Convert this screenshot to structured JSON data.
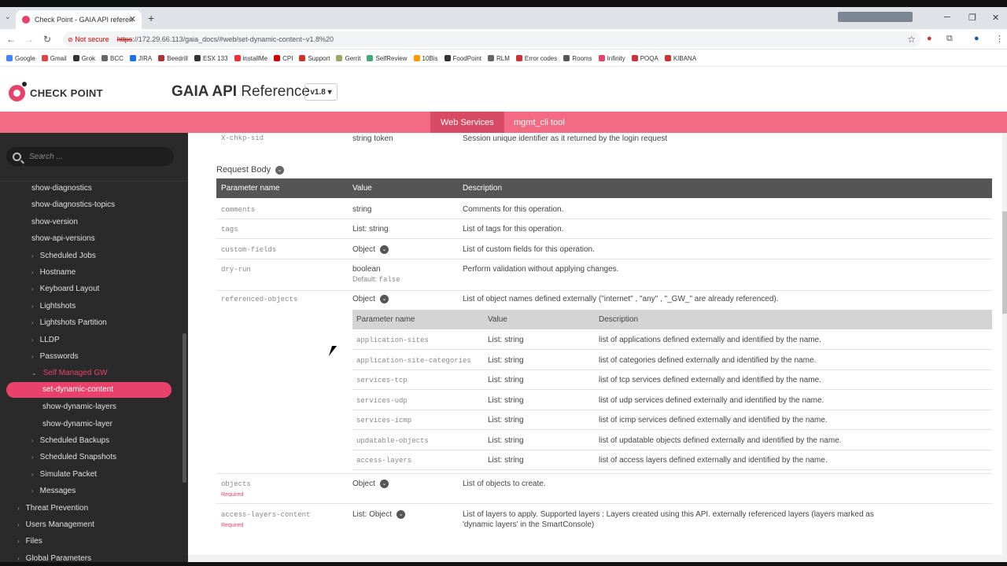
{
  "browser": {
    "tab_title": "Check Point - GAIA API referen",
    "not_secure": "Not secure",
    "url_scheme": "https",
    "url_rest": "://172.29.66.113/gaia_docs/#web/set-dynamic-content~v1.8%20",
    "bookmarks": [
      "Google",
      "Gmail",
      "Grok",
      "BCC",
      "JIRA",
      "Beedrill",
      "ESX 133",
      "installMe",
      "CPI",
      "Support",
      "Gerrit",
      "SelfReview",
      "10Bis",
      "FoodPoint",
      "RLM",
      "Error codes",
      "Rooms",
      "Infinity",
      "POQA",
      "KIBANA"
    ]
  },
  "header": {
    "logo_text": "CHECK POINT",
    "title_bold": "GAIA API",
    "title_rest": " Reference",
    "version": "v1.8 ▾",
    "nav": [
      "Web Services",
      "mgmt_cli tool"
    ]
  },
  "sidebar": {
    "search_placeholder": "Search ...",
    "items": [
      {
        "label": "show-diagnostics",
        "indent": 40,
        "chev": false
      },
      {
        "label": "show-diagnostics-topics",
        "indent": 40,
        "chev": false
      },
      {
        "label": "show-version",
        "indent": 40,
        "chev": false
      },
      {
        "label": "show-api-versions",
        "indent": 40,
        "chev": false
      },
      {
        "label": "Scheduled Jobs",
        "indent": 40,
        "chev": true
      },
      {
        "label": "Hostname",
        "indent": 40,
        "chev": true
      },
      {
        "label": "Keyboard Layout",
        "indent": 40,
        "chev": true
      },
      {
        "label": "Lightshots",
        "indent": 40,
        "chev": true
      },
      {
        "label": "Lightshots Partition",
        "indent": 40,
        "chev": true
      },
      {
        "label": "LLDP",
        "indent": 40,
        "chev": true
      },
      {
        "label": "Passwords",
        "indent": 40,
        "chev": true
      },
      {
        "label": "Self Managed GW",
        "indent": 40,
        "chev": true,
        "open": true
      },
      {
        "label": "set-dynamic-content",
        "indent": 54,
        "chev": false,
        "selected": true
      },
      {
        "label": "show-dynamic-layers",
        "indent": 54,
        "chev": false
      },
      {
        "label": "show-dynamic-layer",
        "indent": 54,
        "chev": false
      },
      {
        "label": "Scheduled Backups",
        "indent": 40,
        "chev": true
      },
      {
        "label": "Scheduled Snapshots",
        "indent": 40,
        "chev": true
      },
      {
        "label": "Simulate Packet",
        "indent": 40,
        "chev": true
      },
      {
        "label": "Messages",
        "indent": 40,
        "chev": true
      },
      {
        "label": "Threat Prevention",
        "indent": 22,
        "chev": true
      },
      {
        "label": "Users Management",
        "indent": 22,
        "chev": true
      },
      {
        "label": "Files",
        "indent": 22,
        "chev": true
      },
      {
        "label": "Global Parameters",
        "indent": 22,
        "chev": true
      }
    ]
  },
  "content": {
    "header_row": {
      "name": "X-chkp-sid",
      "value": "string token",
      "desc": "Session unique identifier as it returned by the login request"
    },
    "request_body_title": "Request Body",
    "columns": [
      "Parameter name",
      "Value",
      "Description"
    ],
    "rows": [
      {
        "name": "comments",
        "value": "string",
        "desc": "Comments for this operation."
      },
      {
        "name": "tags",
        "value": "List: string",
        "desc": "List of tags for this operation."
      },
      {
        "name": "custom-fields",
        "value": "Object",
        "desc": "List of custom fields for this operation.",
        "obj": true
      },
      {
        "name": "dry-run",
        "value": "boolean",
        "default_label": "Default:",
        "default_value": "false",
        "desc": "Perform validation without applying changes."
      },
      {
        "name": "referenced-objects",
        "value": "Object",
        "desc": "List of object names defined externally (\"internet\" , \"any\" , \"_GW_\" are already referenced).",
        "obj": true
      }
    ],
    "nested_rows": [
      {
        "name": "application-sites",
        "value": "List: string",
        "desc": "list of applications defined externally and identified by the name."
      },
      {
        "name": "application-site-categories",
        "value": "List: string",
        "desc": "list of categories defined externally and identified by the name."
      },
      {
        "name": "services-tcp",
        "value": "List: string",
        "desc": "list of tcp services defined externally and identified by the name."
      },
      {
        "name": "services-udp",
        "value": "List: string",
        "desc": "list of udp services defined externally and identified by the name."
      },
      {
        "name": "services-icmp",
        "value": "List: string",
        "desc": "list of icmp services defined externally and identified by the name."
      },
      {
        "name": "updatable-objects",
        "value": "List: string",
        "desc": "list of updatable objects defined externally and identified by the name."
      },
      {
        "name": "access-layers",
        "value": "List: string",
        "desc": "list of access layers defined externally and identified by the name."
      }
    ],
    "after_rows": [
      {
        "name": "objects",
        "required": "Required",
        "value": "Object",
        "desc": "List of objects to create."
      },
      {
        "name": "access-layers-content",
        "required": "Required",
        "value": "List: Object",
        "desc": "List of layers to apply. Supported layers : Layers created using this API. externally referenced layers (layers marked as",
        "desc2": "'dynamic layers' in the SmartConsole)"
      }
    ]
  },
  "colors": {
    "accent": "#e8416a",
    "pinkbar": "#f26b83",
    "sidebar": "#2a2a2a"
  }
}
